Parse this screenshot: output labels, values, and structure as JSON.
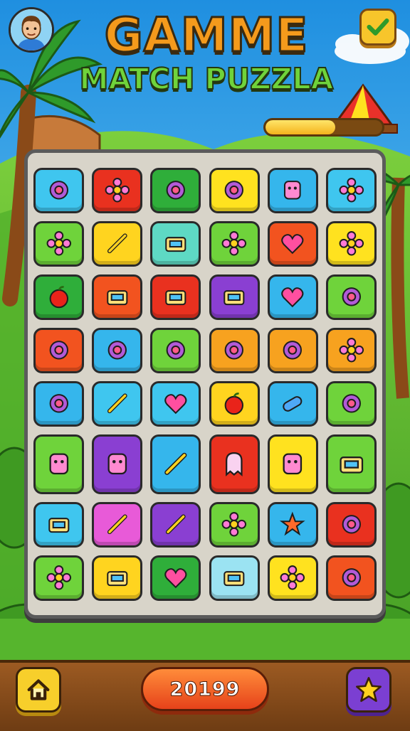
{
  "header": {
    "title": "GAMME",
    "subtitle": "MATCH PUZZLA",
    "avatar_icon": "boy-avatar-icon",
    "confirm_icon": "checkmark-icon"
  },
  "level_progress": {
    "fraction": 0.6
  },
  "board": {
    "rows": 8,
    "cols": 6,
    "tiles": [
      [
        {
          "bg": "#3fc6ef",
          "icon": "smiley-orb-icon"
        },
        {
          "bg": "#e9311f",
          "icon": "flower-orb-icon"
        },
        {
          "bg": "#2fae3a",
          "icon": "slime-icon"
        },
        {
          "bg": "#ffe21f",
          "icon": "smiley-face-icon"
        },
        {
          "bg": "#35b6ec",
          "icon": "robot-badge-icon"
        },
        {
          "bg": "#3fc6ef",
          "icon": "flower-icon"
        }
      ],
      [
        {
          "bg": "#6fd33b",
          "icon": "gear-flower-icon"
        },
        {
          "bg": "#ffd41f",
          "icon": "crossed-sticks-icon"
        },
        {
          "bg": "#5ed9c4",
          "icon": "basket-icon"
        },
        {
          "bg": "#6fd33b",
          "icon": "daisy-icon"
        },
        {
          "bg": "#f2531f",
          "icon": "heart-orb-icon"
        },
        {
          "bg": "#ffe21f",
          "icon": "sun-flower-icon"
        }
      ],
      [
        {
          "bg": "#2fae3a",
          "icon": "apple-icon"
        },
        {
          "bg": "#f2531f",
          "icon": "radio-icon"
        },
        {
          "bg": "#e9311f",
          "icon": "tablet-icon"
        },
        {
          "bg": "#8a3fd2",
          "icon": "folder-icon"
        },
        {
          "bg": "#35b6ec",
          "icon": "heart-ring-icon"
        },
        {
          "bg": "#6fd33b",
          "icon": "ring-icon"
        }
      ],
      [
        {
          "bg": "#f2531f",
          "icon": "bug-icon"
        },
        {
          "bg": "#35b6ec",
          "icon": "target-icon"
        },
        {
          "bg": "#6fd33b",
          "icon": "cat-face-icon"
        },
        {
          "bg": "#f7a21f",
          "icon": "compass-icon"
        },
        {
          "bg": "#f7a21f",
          "icon": "ring-orb-icon"
        },
        {
          "bg": "#f7a21f",
          "icon": "cog-flower-icon"
        }
      ],
      [
        {
          "bg": "#35b6ec",
          "icon": "bubble-icon"
        },
        {
          "bg": "#3fc6ef",
          "icon": "crayon-icon"
        },
        {
          "bg": "#3fc6ef",
          "icon": "heart-icon"
        },
        {
          "bg": "#ffd41f",
          "icon": "tomato-icon"
        },
        {
          "bg": "#35b6ec",
          "icon": "capsule-icon"
        },
        {
          "bg": "#6fd33b",
          "icon": "sun-face-icon"
        }
      ],
      [
        {
          "bg": "#6fd33b",
          "icon": "teddy-robot-icon"
        },
        {
          "bg": "#8a3fd2",
          "icon": "robot-box-icon"
        },
        {
          "bg": "#35b6ec",
          "icon": "wrench-bird-icon"
        },
        {
          "bg": "#e9311f",
          "icon": "ghost-icon"
        },
        {
          "bg": "#ffe21f",
          "icon": "tv-robot-icon"
        },
        {
          "bg": "#6fd33b",
          "icon": "treasure-cart-icon"
        }
      ],
      [
        {
          "bg": "#3fc6ef",
          "icon": "cake-icon"
        },
        {
          "bg": "#e85ad8",
          "icon": "crossed-tools-icon"
        },
        {
          "bg": "#8a3fd2",
          "icon": "pencil-swirl-icon"
        },
        {
          "bg": "#6fd33b",
          "icon": "sunflower-icon"
        },
        {
          "bg": "#35b6ec",
          "icon": "star-flower-icon"
        },
        {
          "bg": "#e9311f",
          "icon": "mushroom-face-icon"
        }
      ],
      [
        {
          "bg": "#6fd33b",
          "icon": "rose-icon"
        },
        {
          "bg": "#ffd41f",
          "icon": "toolbox-icon"
        },
        {
          "bg": "#2fae3a",
          "icon": "big-heart-icon"
        },
        {
          "bg": "#9be3f2",
          "icon": "gift-box-icon"
        },
        {
          "bg": "#ffe21f",
          "icon": "blue-flower-icon"
        },
        {
          "bg": "#f2531f",
          "icon": "pin-ball-icon"
        }
      ]
    ]
  },
  "footer": {
    "home_icon": "home-icon",
    "score": "20199",
    "star_icon": "star-icon"
  }
}
